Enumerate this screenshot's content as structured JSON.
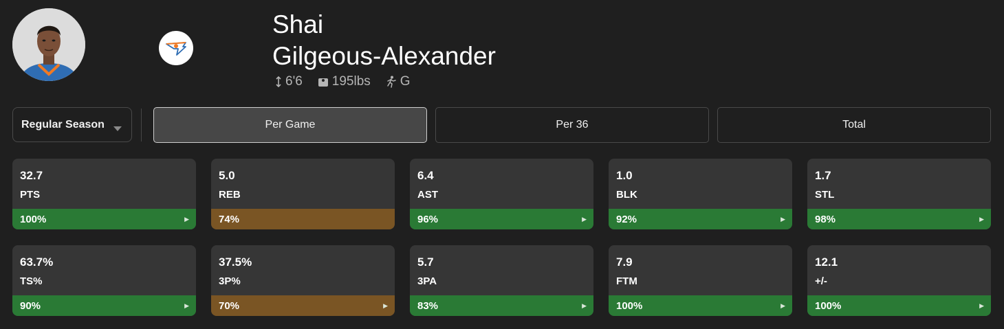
{
  "player": {
    "first_name": "Shai",
    "last_name": "Gilgeous-Alexander",
    "height": "6'6",
    "weight": "195lbs",
    "position": "G"
  },
  "controls": {
    "season_select": "Regular Season",
    "tabs": [
      {
        "label": "Per Game",
        "active": true
      },
      {
        "label": "Per 36",
        "active": false
      },
      {
        "label": "Total",
        "active": false
      }
    ]
  },
  "colors": {
    "green": "#2a7a35",
    "gold": "#7a5524",
    "card": "#363636",
    "background": "#1f1f1f"
  },
  "stats": [
    {
      "value": "32.7",
      "label": "PTS",
      "percentile": "100%",
      "color": "#2a7a35",
      "arrow": true
    },
    {
      "value": "5.0",
      "label": "REB",
      "percentile": "74%",
      "color": "#7a5524",
      "arrow": false
    },
    {
      "value": "6.4",
      "label": "AST",
      "percentile": "96%",
      "color": "#2a7a35",
      "arrow": true
    },
    {
      "value": "1.0",
      "label": "BLK",
      "percentile": "92%",
      "color": "#2a7a35",
      "arrow": true
    },
    {
      "value": "1.7",
      "label": "STL",
      "percentile": "98%",
      "color": "#2a7a35",
      "arrow": true
    },
    {
      "value": "63.7%",
      "label": "TS%",
      "percentile": "90%",
      "color": "#2a7a35",
      "arrow": true
    },
    {
      "value": "37.5%",
      "label": "3P%",
      "percentile": "70%",
      "color": "#7a5524",
      "arrow": true
    },
    {
      "value": "5.7",
      "label": "3PA",
      "percentile": "83%",
      "color": "#2a7a35",
      "arrow": true
    },
    {
      "value": "7.9",
      "label": "FTM",
      "percentile": "100%",
      "color": "#2a7a35",
      "arrow": true
    },
    {
      "value": "12.1",
      "label": "+/-",
      "percentile": "100%",
      "color": "#2a7a35",
      "arrow": true
    }
  ]
}
